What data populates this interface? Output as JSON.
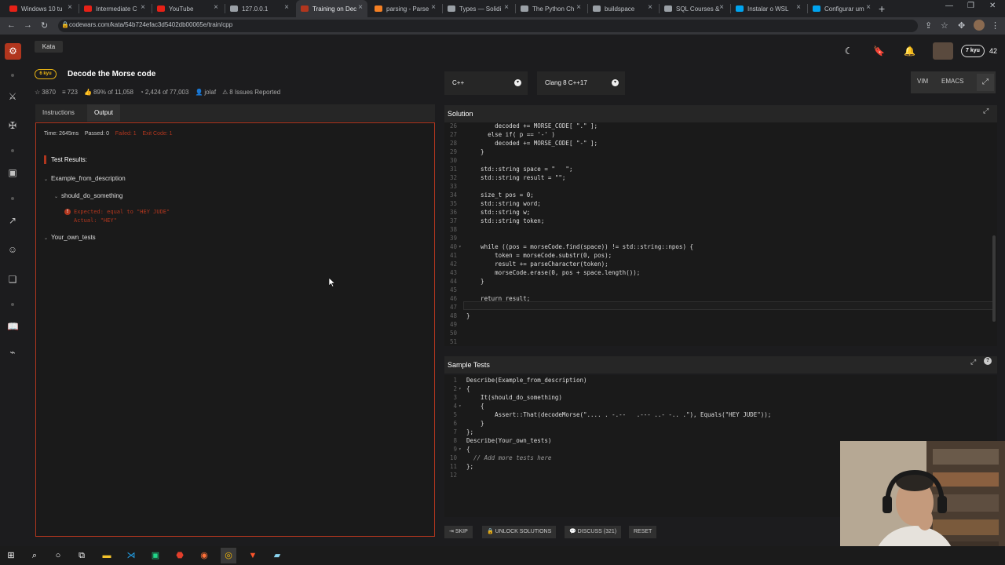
{
  "browser": {
    "tabs": [
      {
        "label": "Windows 10 tu",
        "fav": "#e62117"
      },
      {
        "label": "Intermediate C",
        "fav": "#e62117"
      },
      {
        "label": "YouTube",
        "fav": "#e62117"
      },
      {
        "label": "127.0.0.1",
        "fav": "#9aa0a6"
      },
      {
        "label": "Training on Dec",
        "fav": "#b1361e"
      },
      {
        "label": "parsing - Parse",
        "fav": "#f48024"
      },
      {
        "label": "Types — Solidi",
        "fav": "#9aa0a6"
      },
      {
        "label": "The Python Ch",
        "fav": "#9aa0a6"
      },
      {
        "label": "buildspace",
        "fav": "#9aa0a6"
      },
      {
        "label": "SQL Courses &",
        "fav": "#9aa0a6"
      },
      {
        "label": "Instalar o WSL",
        "fav": "#00a4ef"
      },
      {
        "label": "Configurar um",
        "fav": "#00a4ef"
      }
    ],
    "active_tab_index": 4,
    "new_tab": "+",
    "url": "codewars.com/kata/54b724efac3d5402db00065e/train/cpp"
  },
  "header": {
    "kata_tab": "Kata",
    "rank_badge": "7 kyu",
    "honor": "42"
  },
  "kata": {
    "kyu": "6 kyu",
    "title": "Decode the Morse code",
    "stars": "3870",
    "votes": "723",
    "satisfaction": "89% of 11,058",
    "completions": "2,424 of 77,003",
    "author": "jolaf",
    "issues": "8 Issues Reported"
  },
  "left_tabs": {
    "instructions": "Instructions",
    "output": "Output"
  },
  "output": {
    "time": "Time: 2645ms",
    "passed": "Passed: 0",
    "failed": "Failed: 1",
    "exit_code": "Exit Code: 1",
    "test_results": "Test Results:",
    "describe1": "Example_from_description",
    "it1": "should_do_something",
    "expected": "Expected: equal to \"HEY JUDE\"",
    "actual": "Actual: \"HEY\"",
    "describe2": "Your_own_tests",
    "err_mark": "!",
    "caret": "⌄"
  },
  "editor_settings": {
    "language": "C++",
    "compiler": "Clang 8 C++17",
    "vim": "VIM",
    "emacs": "EMACS"
  },
  "solution": {
    "title": "Solution",
    "lines": [
      {
        "n": "26",
        "code": "        decoded += MORSE_CODE[ \".\" ];"
      },
      {
        "n": "27",
        "code": "      else if( p == '-' )"
      },
      {
        "n": "28",
        "code": "        decoded += MORSE_CODE[ \"-\" ];"
      },
      {
        "n": "29",
        "code": "    }"
      },
      {
        "n": "30",
        "code": ""
      },
      {
        "n": "31",
        "code": "    std::string space = \"   \";"
      },
      {
        "n": "32",
        "code": "    std::string result = \"\";"
      },
      {
        "n": "33",
        "code": ""
      },
      {
        "n": "34",
        "code": "    size_t pos = 0;"
      },
      {
        "n": "35",
        "code": "    std::string word;"
      },
      {
        "n": "36",
        "code": "    std::string w;"
      },
      {
        "n": "37",
        "code": "    std::string token;"
      },
      {
        "n": "38",
        "code": ""
      },
      {
        "n": "39",
        "code": ""
      },
      {
        "n": "40",
        "code": "    while ((pos = morseCode.find(space)) != std::string::npos) {"
      },
      {
        "n": "41",
        "code": "        token = morseCode.substr(0, pos);"
      },
      {
        "n": "42",
        "code": "        result += parseCharacter(token);"
      },
      {
        "n": "43",
        "code": "        morseCode.erase(0, pos + space.length());"
      },
      {
        "n": "44",
        "code": "    }"
      },
      {
        "n": "45",
        "code": ""
      },
      {
        "n": "46",
        "code": "    return result;"
      },
      {
        "n": "47",
        "code": ""
      },
      {
        "n": "48",
        "code": "}"
      },
      {
        "n": "49",
        "code": ""
      },
      {
        "n": "50",
        "code": ""
      },
      {
        "n": "51",
        "code": ""
      }
    ]
  },
  "sample_tests": {
    "title": "Sample Tests",
    "lines": [
      {
        "n": "1",
        "code": "Describe(Example_from_description)"
      },
      {
        "n": "2",
        "code": "{"
      },
      {
        "n": "3",
        "code": "    It(should_do_something)"
      },
      {
        "n": "4",
        "code": "    {"
      },
      {
        "n": "5",
        "code": "        Assert::That(decodeMorse(\".... . -.--   .--- ..- -.. .\"), Equals(\"HEY JUDE\"));"
      },
      {
        "n": "6",
        "code": "    }"
      },
      {
        "n": "7",
        "code": "};"
      },
      {
        "n": "8",
        "code": "Describe(Your_own_tests)"
      },
      {
        "n": "9",
        "code": "{"
      },
      {
        "n": "10",
        "code": "  // Add more tests here"
      },
      {
        "n": "11",
        "code": "};"
      },
      {
        "n": "12",
        "code": ""
      }
    ]
  },
  "buttons": {
    "skip": "SKIP",
    "unlock": "UNLOCK SOLUTIONS",
    "discuss": "DISCUSS (321)",
    "reset": "RESET"
  },
  "colors": {
    "accent": "#b1361e",
    "kyu": "#ecb613",
    "bg": "#1c1c1e"
  }
}
